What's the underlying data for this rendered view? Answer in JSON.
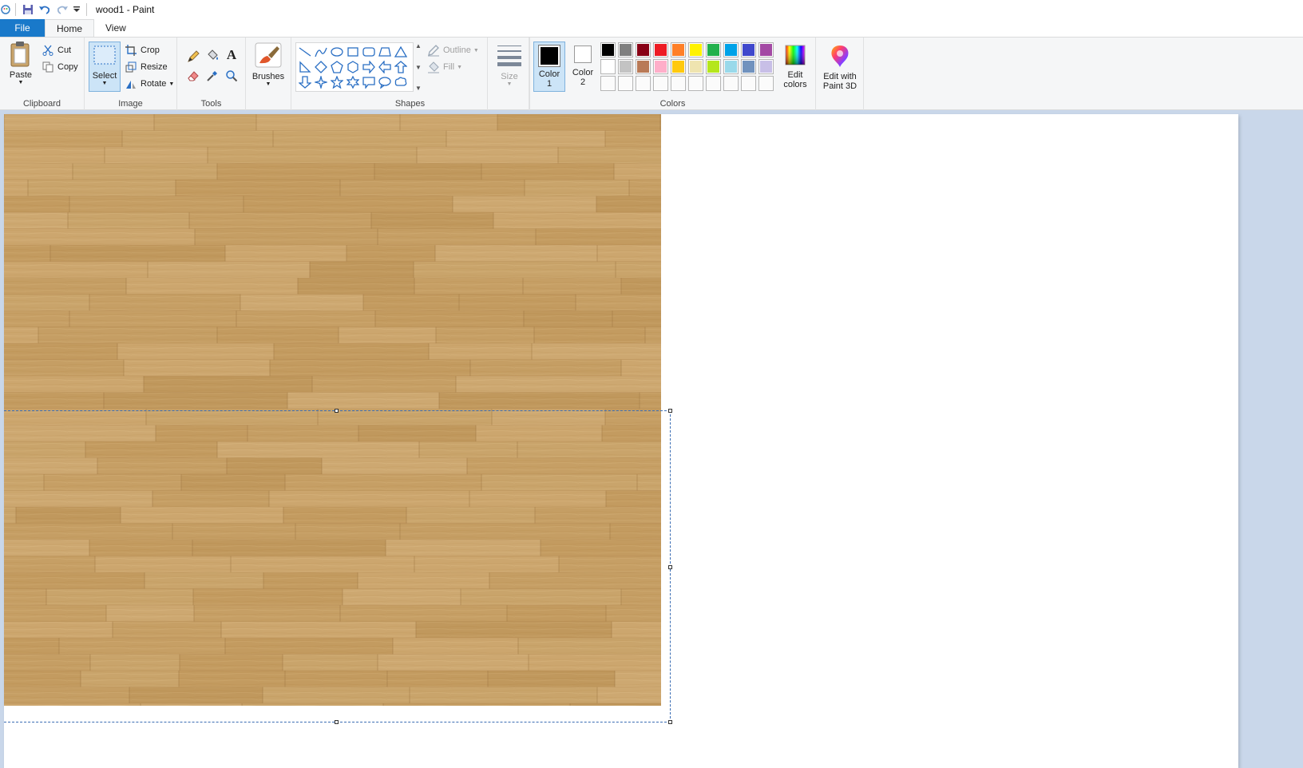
{
  "window": {
    "title": "wood1 - Paint"
  },
  "quick_access": {
    "icons": [
      "paint-app-icon",
      "save-icon",
      "undo-icon",
      "redo-icon",
      "customize-dropdown-icon"
    ]
  },
  "tabs": [
    {
      "label": "File"
    },
    {
      "label": "Home"
    },
    {
      "label": "View"
    }
  ],
  "ribbon": {
    "clipboard": {
      "label": "Clipboard",
      "paste": "Paste",
      "cut": "Cut",
      "copy": "Copy"
    },
    "image": {
      "label": "Image",
      "select": "Select",
      "crop": "Crop",
      "resize": "Resize",
      "rotate": "Rotate"
    },
    "tools": {
      "label": "Tools"
    },
    "brushes": {
      "label": "Brushes"
    },
    "shapes": {
      "label": "Shapes",
      "outline": "Outline",
      "fill": "Fill"
    },
    "size": {
      "label": "Size"
    },
    "colors": {
      "label": "Colors",
      "color1_line1": "Color",
      "color1_line2": "1",
      "color2_line1": "Color",
      "color2_line2": "2",
      "edit_colors_line1": "Edit",
      "edit_colors_line2": "colors",
      "color1_value": "#000000",
      "color2_value": "#ffffff",
      "palette_row1": [
        "#000000",
        "#7f7f7f",
        "#880015",
        "#ed1c24",
        "#ff7f27",
        "#fff200",
        "#22b14c",
        "#00a2e8",
        "#3f48cc",
        "#a349a4"
      ],
      "palette_row2": [
        "#ffffff",
        "#c3c3c3",
        "#b97a57",
        "#ffaec9",
        "#ffc90e",
        "#efe4b0",
        "#b5e61d",
        "#99d9ea",
        "#7092be",
        "#c8bfe7"
      ],
      "palette_row3": [
        "#ffffff",
        "#ffffff",
        "#ffffff",
        "#ffffff",
        "#ffffff",
        "#ffffff",
        "#ffffff",
        "#ffffff",
        "#ffffff",
        "#ffffff"
      ]
    },
    "paint3d": {
      "line1": "Edit with",
      "line2": "Paint 3D"
    }
  },
  "canvas": {
    "image_name": "wood-parquet-texture"
  }
}
